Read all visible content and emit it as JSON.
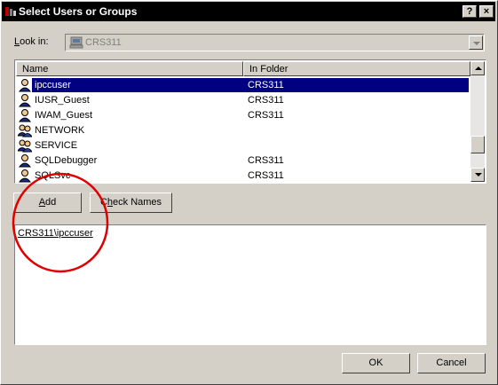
{
  "window": {
    "title": "Select Users or Groups",
    "help_button": "?",
    "close_button": "×"
  },
  "look_in": {
    "label_accel": "L",
    "label_rest": "ook in:",
    "value": "CRS311",
    "icon": "computer-icon"
  },
  "list": {
    "columns": [
      "Name",
      "In Folder"
    ],
    "rows": [
      {
        "name": "ipccuser",
        "folder": "CRS311",
        "icon": "user-icon",
        "selected": true
      },
      {
        "name": "IUSR_Guest",
        "folder": "CRS311",
        "icon": "user-icon"
      },
      {
        "name": "IWAM_Guest",
        "folder": "CRS311",
        "icon": "user-icon"
      },
      {
        "name": "NETWORK",
        "folder": "",
        "icon": "group-icon"
      },
      {
        "name": "SERVICE",
        "folder": "",
        "icon": "group-icon"
      },
      {
        "name": "SQLDebugger",
        "folder": "CRS311",
        "icon": "user-icon"
      },
      {
        "name": "SQLSvc",
        "folder": "CRS311",
        "icon": "user-icon"
      }
    ]
  },
  "buttons": {
    "add_accel": "A",
    "add_rest": "dd",
    "check_pre": "C",
    "check_accel": "h",
    "check_rest": "eck Names",
    "ok": "OK",
    "cancel": "Cancel"
  },
  "added": {
    "items": [
      "CRS311\\ipccuser"
    ]
  },
  "colors": {
    "selection": "#000080",
    "annotation": "#e00000",
    "face": "#d4d0c8"
  }
}
